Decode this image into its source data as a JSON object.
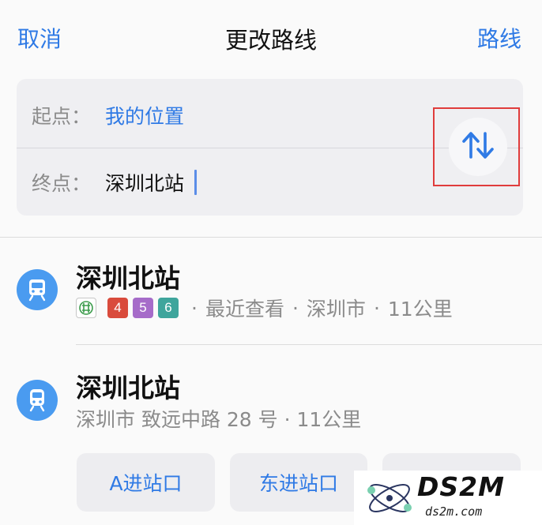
{
  "header": {
    "cancel_label": "取消",
    "title": "更改路线",
    "route_label": "路线"
  },
  "route": {
    "from_label": "起点：",
    "from_value": "我的位置",
    "to_label": "终点：",
    "to_value": "深圳北站",
    "swap_icon": "swap-vertical-arrows-icon"
  },
  "results": [
    {
      "title": "深圳北站",
      "icon": "metro-train-icon",
      "metro_logo": "深圳地铁",
      "lines": [
        {
          "label": "4",
          "color": "#d94b3c"
        },
        {
          "label": "5",
          "color": "#a66cc9"
        },
        {
          "label": "6",
          "color": "#3fa59c"
        }
      ],
      "recent": "最近查看",
      "city": "深圳市",
      "distance": "11公里"
    },
    {
      "title": "深圳北站",
      "icon": "train-icon",
      "subtitle": "深圳市 致远中路 28 号 · 11公里"
    }
  ],
  "entrances": [
    "A进站口",
    "东进站口",
    "…"
  ],
  "watermark": {
    "text": "DS2M",
    "sub": "ds2m.com"
  },
  "colors": {
    "accent": "#2f7ae5",
    "place_icon_bg": "#4a9bf0",
    "highlight": "#e03c3c"
  }
}
